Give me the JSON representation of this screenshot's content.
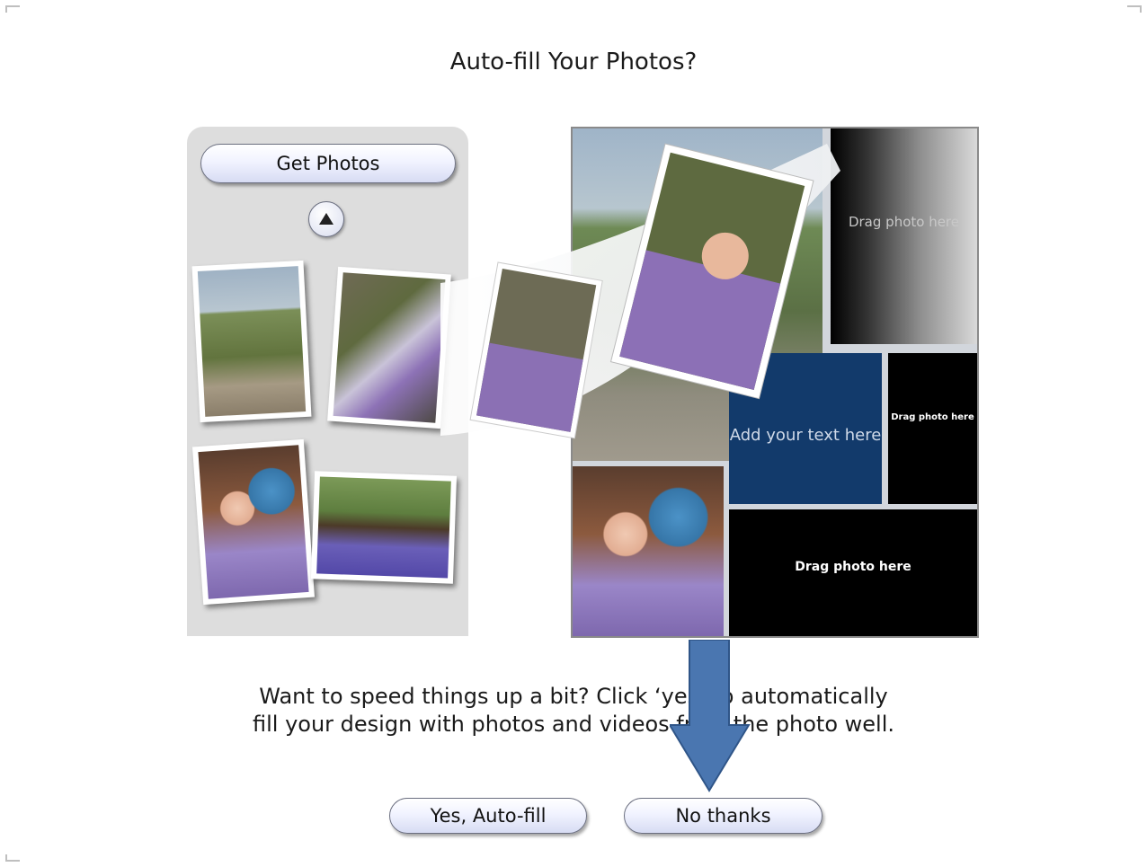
{
  "dialog": {
    "title": "Auto-fill Your Photos?",
    "description_line1": "Want to speed things up a bit? Click ‘yes’ to automatically",
    "description_line2": "fill your design with photos and videos from the photo well."
  },
  "illustration": {
    "get_photos_label": "Get Photos",
    "drag_photo_here_gradient": "Drag photo here",
    "add_text_here": "Add your text here",
    "drag_photo_here_small": "Drag photo here",
    "drag_photo_here_bottom": "Drag photo here"
  },
  "buttons": {
    "yes_label": "Yes, Auto-fill",
    "no_label": "No thanks"
  },
  "annotation": {
    "arrow_color": "#4a76b0",
    "arrow_direction": "down"
  }
}
